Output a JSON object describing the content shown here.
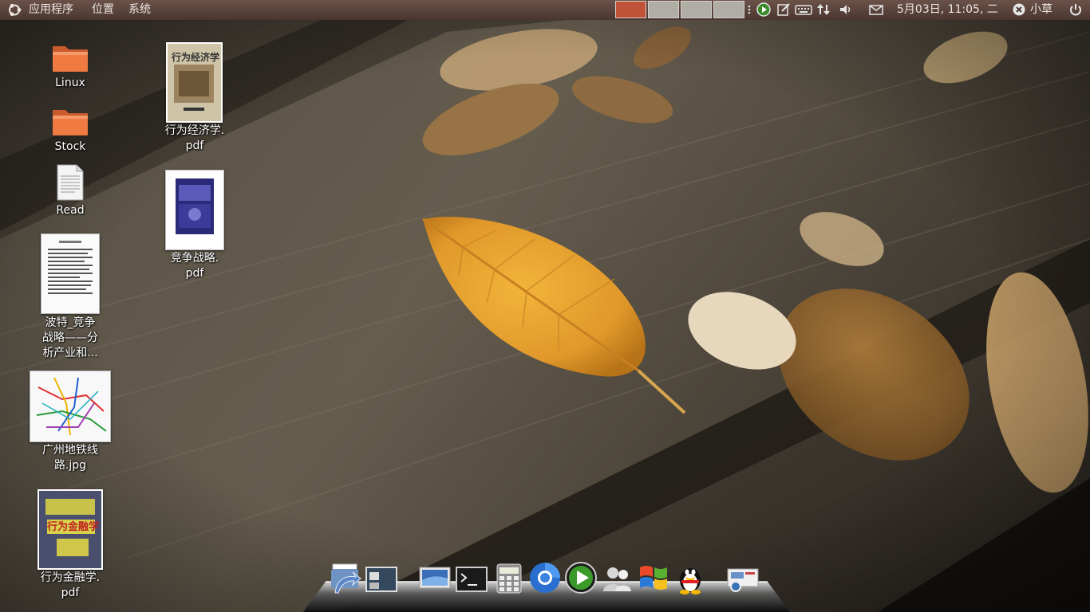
{
  "top_panel": {
    "menu_apps": "应用程序",
    "menu_places": "位置",
    "menu_system": "系统",
    "clock": "5月03日, 11:05, 二",
    "user_name": "小草",
    "workspaces": 4,
    "active_workspace": 1
  },
  "desktop": {
    "icons": [
      {
        "name": "folder-linux",
        "label": "Linux"
      },
      {
        "name": "folder-stock",
        "label": "Stock"
      },
      {
        "name": "file-read",
        "label": "Read"
      },
      {
        "name": "pdf-porter",
        "line1": "波特_竞争",
        "line2": "战略——分",
        "line3": "析产业和..."
      },
      {
        "name": "jpg-metro",
        "line1": "广州地铁线",
        "line2": "路.jpg"
      },
      {
        "name": "pdf-behavioral-finance",
        "line1": "行为金融学.",
        "line2": "pdf"
      },
      {
        "name": "pdf-behavioral-economics",
        "line1": "行为经济学.",
        "line2": "pdf"
      },
      {
        "name": "pdf-competitive-strategy",
        "line1": "竞争战略.",
        "line2": "pdf"
      }
    ],
    "thumb_text": {
      "behavioral_economics_title": "行为经济学",
      "behavioral_finance_title": "行为金融学"
    }
  },
  "dock": {
    "items": [
      "home-folder-icon",
      "show-desktop-icon",
      "display-settings-icon",
      "terminal-icon",
      "calculator-icon",
      "chromium-icon",
      "media-player-icon",
      "empathy-icon",
      "windows-icon",
      "qq-icon",
      "screenshot-icon"
    ]
  },
  "colors": {
    "panel_top": "#6b5248",
    "panel_bottom": "#4a3630",
    "active_workspace": "#c0533a",
    "inactive_workspace": "#b0aca6",
    "folder_orange": "#e7743c"
  }
}
